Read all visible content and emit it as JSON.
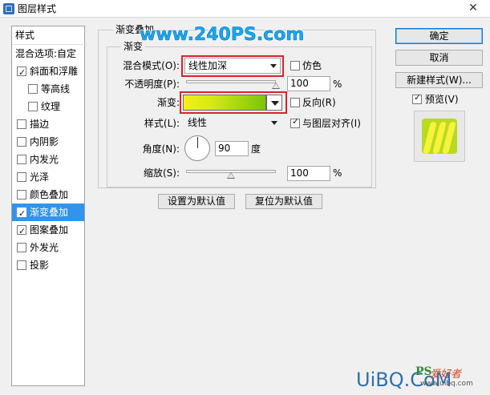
{
  "window": {
    "title": "图层样式",
    "close_glyph": "✕"
  },
  "watermark": {
    "text": "www.240PS.com",
    "color": "#1aa7f0"
  },
  "site_logo": {
    "letters": "UiBQ.CoM",
    "ps": "PS",
    "cn": "爱好者",
    "url": "www.uibq.com"
  },
  "left_panel": {
    "styles_header": "样式",
    "blend_options": "混合选项:自定",
    "items": [
      {
        "label": "斜面和浮雕",
        "checked": true,
        "indent": false,
        "selected": false
      },
      {
        "label": "等高线",
        "checked": false,
        "indent": true,
        "selected": false
      },
      {
        "label": "纹理",
        "checked": false,
        "indent": true,
        "selected": false
      },
      {
        "label": "描边",
        "checked": false,
        "indent": false,
        "selected": false
      },
      {
        "label": "内阴影",
        "checked": false,
        "indent": false,
        "selected": false
      },
      {
        "label": "内发光",
        "checked": false,
        "indent": false,
        "selected": false
      },
      {
        "label": "光泽",
        "checked": false,
        "indent": false,
        "selected": false
      },
      {
        "label": "颜色叠加",
        "checked": false,
        "indent": false,
        "selected": false
      },
      {
        "label": "渐变叠加",
        "checked": true,
        "indent": false,
        "selected": true
      },
      {
        "label": "图案叠加",
        "checked": true,
        "indent": false,
        "selected": false
      },
      {
        "label": "外发光",
        "checked": false,
        "indent": false,
        "selected": false
      },
      {
        "label": "投影",
        "checked": false,
        "indent": false,
        "selected": false
      }
    ],
    "selection_color": "#3393ea"
  },
  "gradient_overlay": {
    "group_title": "渐变叠加",
    "sub_group_title": "渐变",
    "blend_mode": {
      "label": "混合模式(O):",
      "value": "线性加深"
    },
    "dither": {
      "label": "仿色",
      "checked": false
    },
    "opacity": {
      "label": "不透明度(P):",
      "value": "100",
      "unit": "%",
      "fraction": 1.0
    },
    "gradient": {
      "label": "渐变:",
      "colors": [
        "#f4f01a",
        "#d7ea14",
        "#a6d80f",
        "#7bc50c"
      ]
    },
    "reverse": {
      "label": "反向(R)",
      "checked": false
    },
    "style": {
      "label": "样式(L):",
      "value": "线性"
    },
    "align_with_layer": {
      "label": "与图层对齐(I)",
      "checked": true
    },
    "angle": {
      "label": "角度(N):",
      "value": "90",
      "unit": "度"
    },
    "scale": {
      "label": "缩放(S):",
      "value": "100",
      "unit": "%",
      "fraction": 0.5
    },
    "buttons": {
      "make_default": "设置为默认值",
      "reset_default": "复位为默认值"
    },
    "highlight_color": "#d9232b"
  },
  "right_panel": {
    "ok": "确定",
    "cancel": "取消",
    "new_style": "新建样式(W)...",
    "preview": {
      "label": "预览(V)",
      "checked": true
    },
    "preview_colors": {
      "base": "#b8da20",
      "stripe": "#f7f23a"
    }
  }
}
